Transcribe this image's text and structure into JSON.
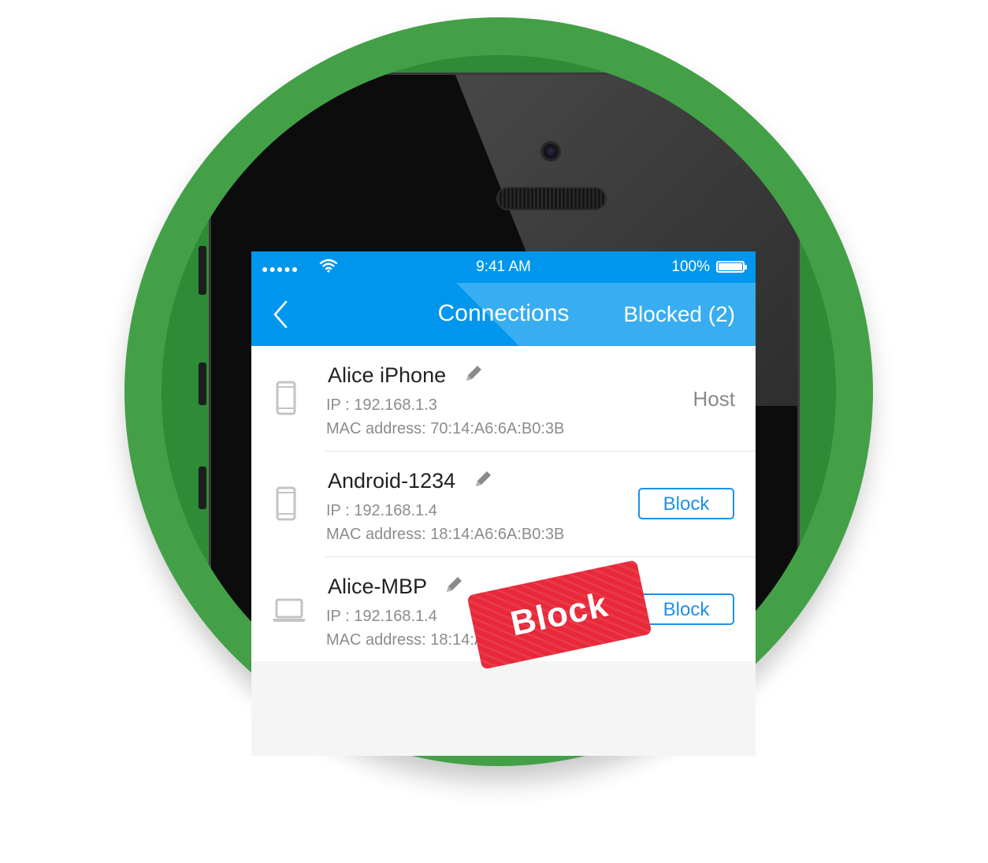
{
  "status_bar": {
    "signal": "●●●●●",
    "time": "9:41 AM",
    "battery": "100%"
  },
  "nav": {
    "title": "Connections",
    "blocked_link": "Blocked (2)"
  },
  "devices": [
    {
      "name": "Alice iPhone",
      "ip": "IP : 192.168.1.3",
      "mac": "MAC address: 70:14:A6:6A:B0:3B",
      "status": "Host",
      "icon": "phone-icon"
    },
    {
      "name": "Android-1234",
      "ip": "IP : 192.168.1.4",
      "mac": "MAC address: 18:14:A6:6A:B0:3B",
      "action": "Block",
      "icon": "phone-icon"
    },
    {
      "name": "Alice-MBP",
      "ip": "IP : 192.168.1.4",
      "mac": "MAC address: 18:14:A6:6A:B0:3B",
      "action": "Block",
      "icon": "laptop-icon"
    }
  ],
  "stamp": {
    "text": "Block"
  },
  "colors": {
    "accent": "#0096ee",
    "ring": "#43a047",
    "stamp": "#e8293a"
  }
}
